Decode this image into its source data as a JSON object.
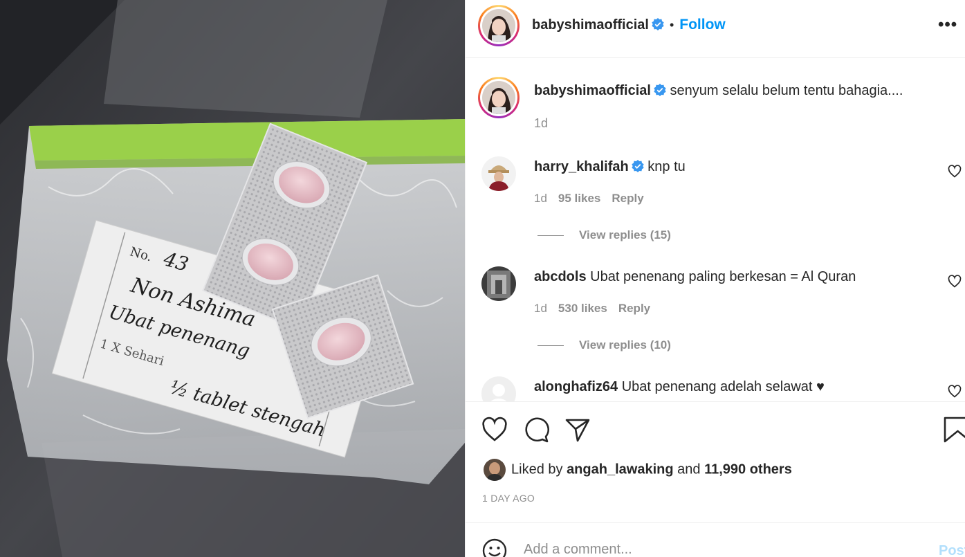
{
  "post": {
    "author": "babyshimaofficial",
    "follow_label": "Follow",
    "separator": "•",
    "more_label": "•••",
    "photo_alt": "Photo of pill blister packs in a plastic bag with a handwritten label",
    "handwriting": {
      "no_label": "No.",
      "no_value": "43",
      "name": "Non Ashima",
      "line1": "Ubat penenang",
      "line2": "1 X Sehari",
      "line3": "½ tablet stengah"
    }
  },
  "caption": {
    "username": "babyshimaofficial",
    "text": "senyum selalu belum tentu bahagia....",
    "time": "1d"
  },
  "comments": [
    {
      "username": "harry_khalifah",
      "verified": true,
      "text": "knp tu",
      "time": "1d",
      "likes": "95 likes",
      "reply_label": "Reply",
      "view_replies": "View replies (15)"
    },
    {
      "username": "abcdols",
      "verified": false,
      "text": "Ubat penenang paling berkesan = Al Quran",
      "time": "1d",
      "likes": "530 likes",
      "reply_label": "Reply",
      "view_replies": "View replies (10)"
    },
    {
      "username": "alonghafiz64",
      "verified": false,
      "text": "Ubat penenang adelah selawat ♥"
    }
  ],
  "likes": {
    "prefix": "Liked by",
    "user": "angah_lawaking",
    "and": "and",
    "others": "11,990 others"
  },
  "timestamp": "1 DAY AGO",
  "add_comment": {
    "placeholder": "Add a comment...",
    "post_label": "Post"
  },
  "colors": {
    "link_blue": "#0095f6",
    "verified_blue": "#3897f0",
    "secondary_text": "#8e8e8e",
    "disabled_post": "#b2dffc"
  },
  "icons": [
    "verified-badge-icon",
    "more-options-icon",
    "heart-icon",
    "comment-icon",
    "share-icon",
    "bookmark-icon",
    "emoji-icon"
  ]
}
